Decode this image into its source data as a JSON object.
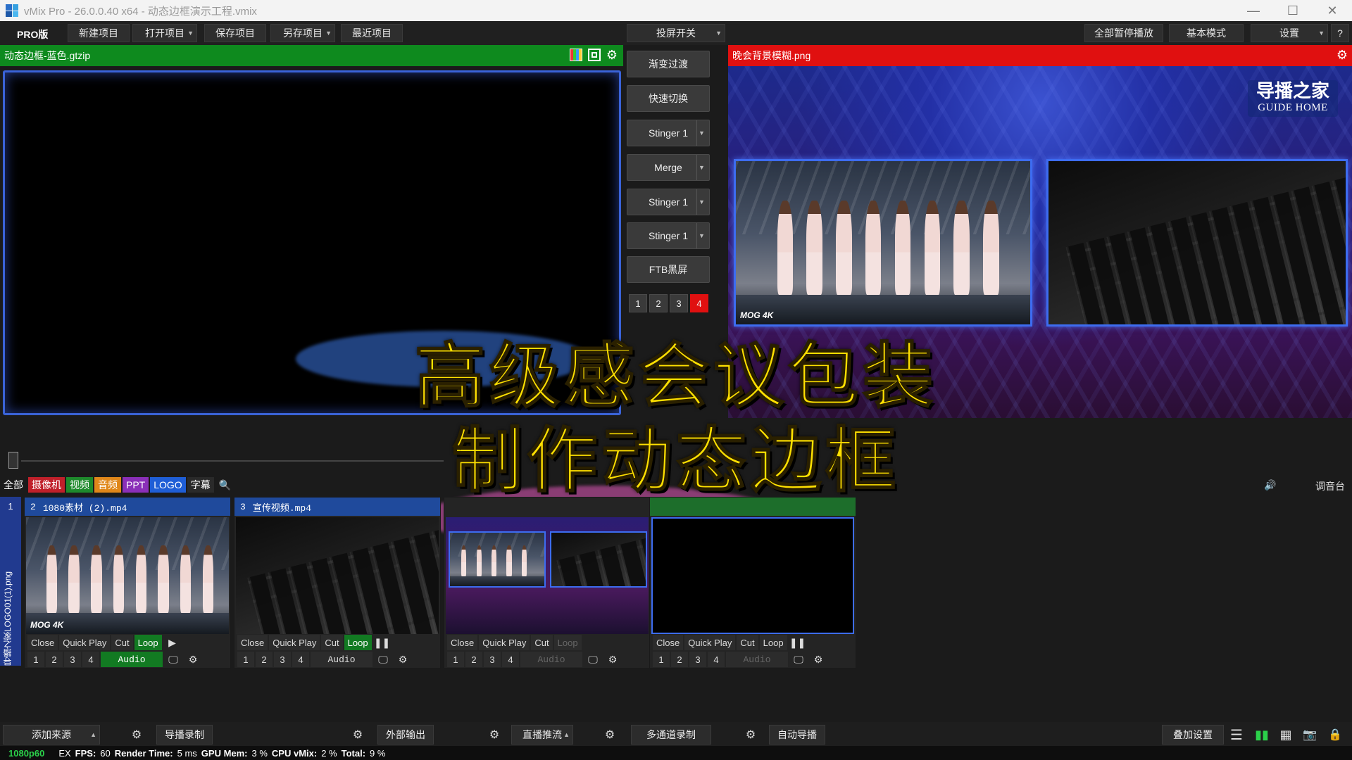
{
  "titlebar": {
    "title": "vMix Pro - 26.0.0.40 x64 - 动态边框演示工程.vmix"
  },
  "menu": {
    "edition": "PRO版",
    "new": "新建项目",
    "open": "打开项目",
    "save": "保存项目",
    "save_as": "另存项目",
    "recent": "最近项目",
    "projector": "投屏开关",
    "pause_all": "全部暂停播放",
    "basic_mode": "基本模式",
    "settings": "设置",
    "help": "?"
  },
  "preview": {
    "title": "动态边框-蓝色.gtzip"
  },
  "transitions": {
    "fade": "渐变过渡",
    "cut": "快速切换",
    "t1": "Stinger 1",
    "t2": "Merge",
    "t3": "Stinger 1",
    "t4": "Stinger 1",
    "ftb": "FTB黑屏",
    "numbers": [
      "1",
      "2",
      "3",
      "4"
    ]
  },
  "output": {
    "title": "晚会背景模糊.png",
    "brand_cn": "导播之家",
    "brand_en": "GUIDE HOME",
    "thumb_mark": "MOG 4K"
  },
  "headline": {
    "line1": "高级感会议包装",
    "line2": "制作动态边框"
  },
  "categories": {
    "all": "全部",
    "camera": "摄像机",
    "video": "视频",
    "audio": "音频",
    "ppt": "PPT",
    "logo": "LOGO",
    "caption": "字幕",
    "mixer": "调音台"
  },
  "inputs": {
    "lane_number": "1",
    "lane_label": "导播之家LOGO01(1).png",
    "cards": [
      {
        "number": "2",
        "title": "1080素材 (2).mp4",
        "mark": "MOG 4K"
      },
      {
        "number": "3",
        "title": "宣传视频.mp4"
      },
      {
        "number": "",
        "title": ""
      },
      {
        "number": "",
        "title": ""
      }
    ],
    "close": "Close",
    "quick_play": "Quick Play",
    "cut": "Cut",
    "loop": "Loop",
    "audio": "Audio",
    "nums": [
      "1",
      "2",
      "3",
      "4"
    ]
  },
  "bottom": {
    "add_input": "添加来源",
    "record": "导播录制",
    "external": "外部输出",
    "stream": "直播推流",
    "multicorder": "多通道录制",
    "playlist": "自动导播",
    "overlay_settings": "叠加设置"
  },
  "status": {
    "resolution": "1080p60",
    "ex": "EX",
    "fps_label": "FPS:",
    "fps": "60",
    "render_label": "Render Time:",
    "render": "5 ms",
    "gpu_label": "GPU Mem:",
    "gpu": "3 %",
    "cpu_label": "CPU vMix:",
    "cpu": "2 %",
    "total_label": "Total:",
    "total": "9 %"
  },
  "colors": {
    "preview_header": "#0e8a1e",
    "output_header": "#e01010",
    "active_button": "#127a22",
    "headline": "#ffe000",
    "frame_blue": "#3d6cf0"
  }
}
